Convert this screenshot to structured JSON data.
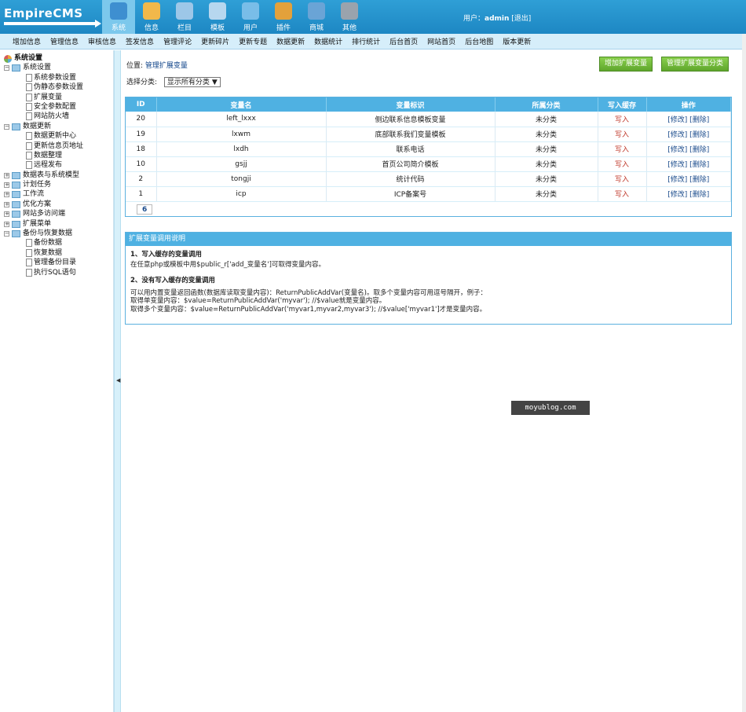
{
  "app": {
    "logo_text": "EmpireCMS"
  },
  "nav": [
    {
      "label": "系统",
      "icon": "globe-icon",
      "color": "#3e8fd0",
      "active": true
    },
    {
      "label": "信息",
      "icon": "edit-icon",
      "color": "#f1b84a"
    },
    {
      "label": "栏目",
      "icon": "folder-icon",
      "color": "#9dc7e8"
    },
    {
      "label": "模板",
      "icon": "window-icon",
      "color": "#b7d7ef"
    },
    {
      "label": "用户",
      "icon": "user-icon",
      "color": "#79bde8"
    },
    {
      "label": "插件",
      "icon": "tools-icon",
      "color": "#e3a13b"
    },
    {
      "label": "商城",
      "icon": "card-icon",
      "color": "#6aa4d6"
    },
    {
      "label": "其他",
      "icon": "gear-icon",
      "color": "#9aa3ad"
    }
  ],
  "user": {
    "prefix": "用户：",
    "name": "admin",
    "logout": "[退出]"
  },
  "menubar": [
    "增加信息",
    "管理信息",
    "审核信息",
    "签发信息",
    "管理评论",
    "更新碎片",
    "更新专题",
    "数据更新",
    "数据统计",
    "排行统计",
    "后台首页",
    "网站首页",
    "后台地图",
    "版本更新"
  ],
  "sidebar": {
    "root": "系统设置",
    "items": [
      {
        "label": "系统设置",
        "level": 0,
        "type": "folder",
        "expanded": true
      },
      {
        "label": "系统参数设置",
        "level": 1,
        "type": "doc"
      },
      {
        "label": "伪静态参数设置",
        "level": 1,
        "type": "doc"
      },
      {
        "label": "扩展变量",
        "level": 1,
        "type": "doc"
      },
      {
        "label": "安全参数配置",
        "level": 1,
        "type": "doc"
      },
      {
        "label": "网站防火墙",
        "level": 1,
        "type": "doc"
      },
      {
        "label": "数据更新",
        "level": 0,
        "type": "folder",
        "expanded": true
      },
      {
        "label": "数据更新中心",
        "level": 1,
        "type": "doc"
      },
      {
        "label": "更新信息页地址",
        "level": 1,
        "type": "doc"
      },
      {
        "label": "数据整理",
        "level": 1,
        "type": "doc"
      },
      {
        "label": "远程发布",
        "level": 1,
        "type": "doc"
      },
      {
        "label": "数据表与系统模型",
        "level": 0,
        "type": "folder",
        "expanded": false
      },
      {
        "label": "计划任务",
        "level": 0,
        "type": "folder",
        "expanded": false
      },
      {
        "label": "工作流",
        "level": 0,
        "type": "folder",
        "expanded": false
      },
      {
        "label": "优化方案",
        "level": 0,
        "type": "folder",
        "expanded": false
      },
      {
        "label": "网站多访问端",
        "level": 0,
        "type": "folder",
        "expanded": false
      },
      {
        "label": "扩展菜单",
        "level": 0,
        "type": "folder",
        "expanded": false
      },
      {
        "label": "备份与恢复数据",
        "level": 0,
        "type": "folder",
        "expanded": true
      },
      {
        "label": "备份数据",
        "level": 1,
        "type": "doc"
      },
      {
        "label": "恢复数据",
        "level": 1,
        "type": "doc"
      },
      {
        "label": "管理备份目录",
        "level": 1,
        "type": "doc"
      },
      {
        "label": "执行SQL语句",
        "level": 1,
        "type": "doc"
      }
    ]
  },
  "main": {
    "crumb_prefix": "位置:",
    "crumb_link": "管理扩展变量",
    "btn_add": "增加扩展变量",
    "btn_manage_class": "管理扩展变量分类",
    "select_label": "选择分类:",
    "select_value": "显示所有分类",
    "columns": [
      "ID",
      "变量名",
      "变量标识",
      "所属分类",
      "写入缓存",
      "操作"
    ],
    "rows": [
      {
        "id": "20",
        "name": "left_lxxx",
        "title": "侧边联系信息模板变量",
        "cat": "未分类",
        "cache": "写入",
        "op": "[修改] [删除]"
      },
      {
        "id": "19",
        "name": "lxwm",
        "title": "底部联系我们变量模板",
        "cat": "未分类",
        "cache": "写入",
        "op": "[修改] [删除]"
      },
      {
        "id": "18",
        "name": "lxdh",
        "title": "联系电话",
        "cat": "未分类",
        "cache": "写入",
        "op": "[修改] [删除]"
      },
      {
        "id": "10",
        "name": "gsjj",
        "title": "首页公司简介模板",
        "cat": "未分类",
        "cache": "写入",
        "op": "[修改] [删除]"
      },
      {
        "id": "2",
        "name": "tongji",
        "title": "统计代码",
        "cat": "未分类",
        "cache": "写入",
        "op": "[修改] [删除]"
      },
      {
        "id": "1",
        "name": "icp",
        "title": "ICP备案号",
        "cat": "未分类",
        "cache": "写入",
        "op": "[修改] [删除]"
      }
    ],
    "pager": "6",
    "help": {
      "title": "扩展变量调用说明",
      "h1": "1、写入缓存的变量调用",
      "p1": "在任意php或模板中用$public_r['add_变量名']可取得变量内容。",
      "h2": "2、没有写入缓存的变量调用",
      "p2": "可以用内置变量返回函数(数据库读取变量内容)：ReturnPublicAddVar(变量名)。取多个变量内容可用逗号隔开，例子：",
      "p3": "取得单变量内容：$value=ReturnPublicAddVar('myvar'); //$value就是变量内容。",
      "p4": "取得多个变量内容：$value=ReturnPublicAddVar('myvar1,myvar2,myvar3'); //$value['myvar1']才是变量内容。"
    }
  },
  "watermark": "moyublog.com"
}
